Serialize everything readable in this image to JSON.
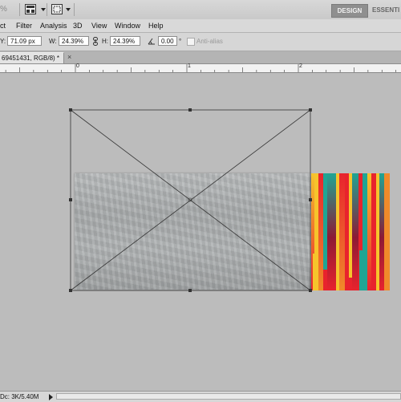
{
  "appbar": {
    "zoom_fragment": "%",
    "workspace_active": "DESIGN",
    "workspace_other": "ESSENTI",
    "icons": [
      "arrange-documents-icon",
      "screen-mode-icon"
    ]
  },
  "menu": {
    "items": [
      "ct",
      "Filter",
      "Analysis",
      "3D",
      "View",
      "Window",
      "Help"
    ]
  },
  "options": {
    "y_label": "Y:",
    "y_value": "71.09 px",
    "w_label": "W:",
    "w_value": "24.39%",
    "h_label": "H:",
    "h_value": "24.39%",
    "angle_value": "0.00",
    "degree_symbol": "°",
    "antialias_label": "Anti-alias"
  },
  "document": {
    "tab_title": "69451431, RGB/8) *",
    "close": "×"
  },
  "ruler": {
    "numbers": [
      "0",
      "1",
      "2"
    ]
  },
  "status": {
    "doc_size": "Dc: 3K/5.40M"
  },
  "colors": {
    "stripe_red": "#e8232d",
    "stripe_teal": "#1fa594",
    "stripe_yellow": "#f6c42c",
    "stripe_orange": "#f08a2a",
    "stripe_maroon": "#8d1a35"
  }
}
